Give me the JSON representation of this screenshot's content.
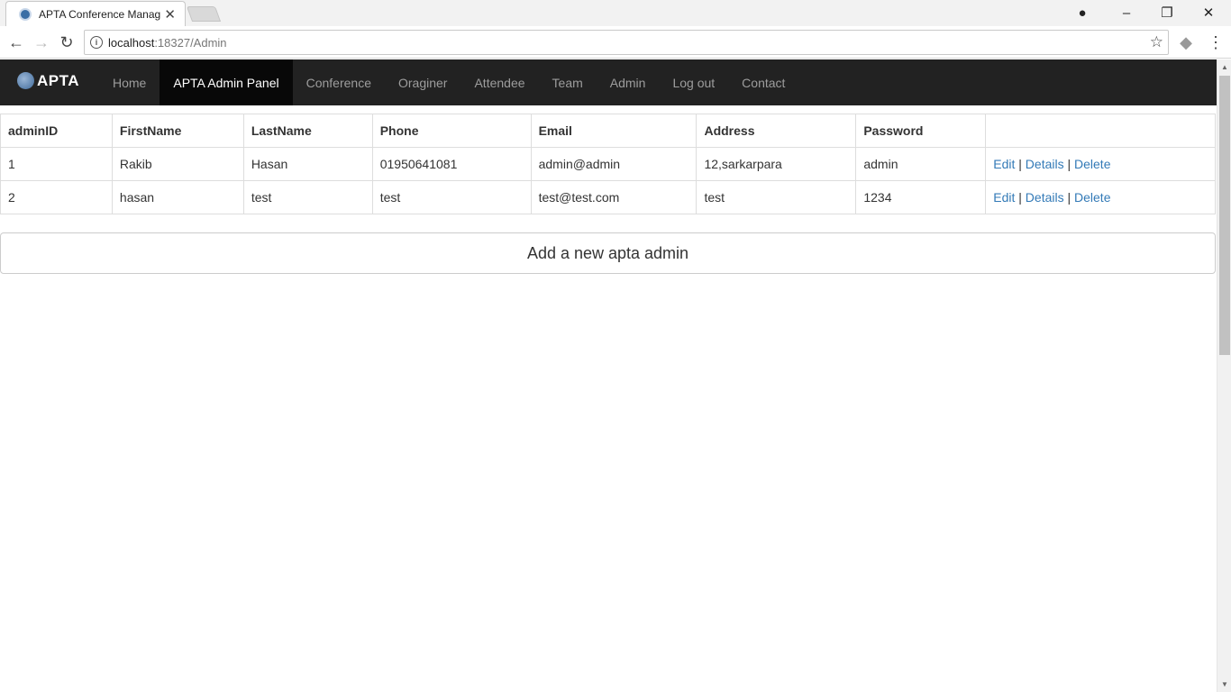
{
  "browser": {
    "tab_title": "APTA Conference Manag",
    "url_host": "localhost",
    "url_path": ":18327/Admin"
  },
  "nav": {
    "brand": "APTA",
    "items": [
      {
        "label": "Home",
        "active": false
      },
      {
        "label": "APTA Admin Panel",
        "active": true
      },
      {
        "label": "Conference",
        "active": false
      },
      {
        "label": "Oraginer",
        "active": false
      },
      {
        "label": "Attendee",
        "active": false
      },
      {
        "label": "Team",
        "active": false
      },
      {
        "label": "Admin",
        "active": false
      },
      {
        "label": "Log out",
        "active": false
      },
      {
        "label": "Contact",
        "active": false
      }
    ]
  },
  "table": {
    "headers": [
      "adminID",
      "FirstName",
      "LastName",
      "Phone",
      "Email",
      "Address",
      "Password",
      ""
    ],
    "rows": [
      {
        "adminID": "1",
        "FirstName": "Rakib",
        "LastName": "Hasan",
        "Phone": "01950641081",
        "Email": "admin@admin",
        "Address": "12,sarkarpara",
        "Password": "admin"
      },
      {
        "adminID": "2",
        "FirstName": "hasan",
        "LastName": "test",
        "Phone": "test",
        "Email": "test@test.com",
        "Address": "test",
        "Password": "1234"
      }
    ],
    "actions": {
      "edit": "Edit",
      "details": "Details",
      "delete": "Delete",
      "separator": "|"
    }
  },
  "add_button_label": "Add a new apta admin",
  "colors": {
    "navbar_bg": "#222222",
    "navbar_active_bg": "#080808",
    "link": "#337ab7"
  }
}
